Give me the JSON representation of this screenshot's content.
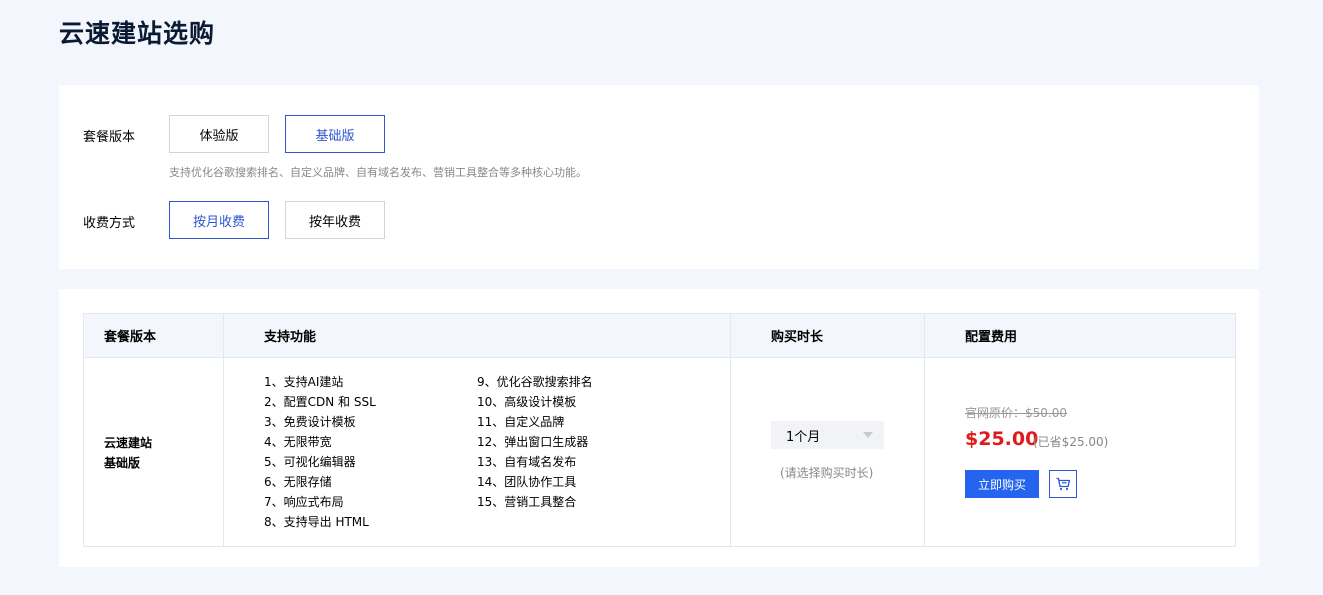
{
  "page_title": "云速建站选购",
  "config": {
    "package_label": "套餐版本",
    "package_options": [
      "体验版",
      "基础版"
    ],
    "package_selected": "基础版",
    "package_desc": "支持优化谷歌搜索排名、自定义品牌、自有域名发布、营销工具整合等多种核心功能。",
    "billing_label": "收费方式",
    "billing_options": [
      "按月收费",
      "按年收费"
    ],
    "billing_selected": "按月收费"
  },
  "summary": {
    "headers": [
      "套餐版本",
      "支持功能",
      "购买时长",
      "配置费用"
    ],
    "package_name_line1": "云速建站",
    "package_name_line2": "基础版",
    "features_left": [
      "1、支持AI建站",
      "2、配置CDN 和 SSL",
      "3、免费设计模板",
      "4、无限带宽",
      "5、可视化编辑器",
      "6、无限存储",
      "7、响应式布局",
      "8、支持导出 HTML"
    ],
    "features_right": [
      "9、优化谷歌搜索排名",
      "10、高级设计模板",
      "11、自定义品牌",
      "12、弹出窗口生成器",
      "13、自有域名发布",
      "14、团队协作工具",
      "15、营销工具整合"
    ],
    "duration_value": "1个月",
    "duration_hint": "(请选择购买时长)",
    "original_price": "官网原价：$50.00",
    "current_price": "$25.00",
    "saved": "(已省$25.00)",
    "buy_label": "立即购买"
  },
  "colors": {
    "accent": "#2f56d2",
    "buy_button": "#2464ee",
    "price": "#e01a1a",
    "background": "#f3f6fc"
  },
  "icons": {
    "cart": "shopping-cart-icon",
    "dropdown": "caret-down-icon"
  }
}
